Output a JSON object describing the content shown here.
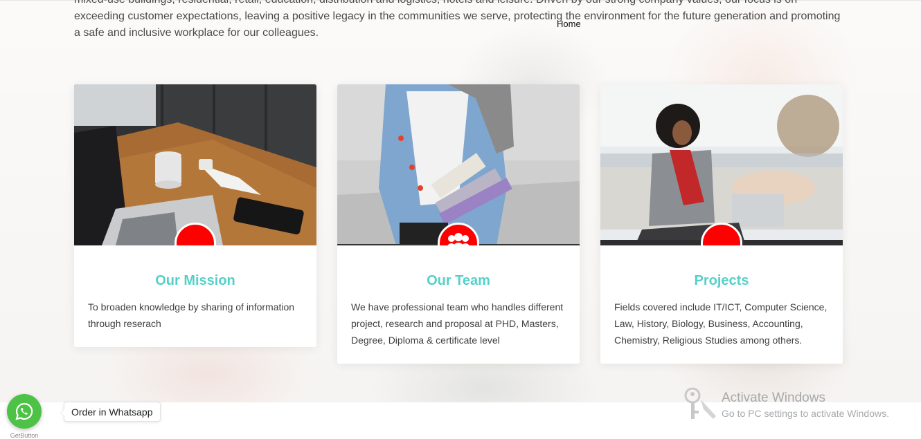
{
  "intro": {
    "text": "mixed-use buildings, residential, retail, education, distribution and logistics, hotels and leisure. Driven by our strong company values, our focus is on exceeding customer expectations, leaving a positive legacy in the communities we serve, protecting the environment for the future generation and promoting a safe and inclusive workplace for our colleagues."
  },
  "nav": {
    "home_label": "Home"
  },
  "cards": [
    {
      "title": "Our Mission",
      "text": "To broaden knowledge by sharing of information through reserach",
      "image": "laptop-coffee-desk-photo",
      "badge_icon": "none"
    },
    {
      "title": "Our Team",
      "text": "We have professional team who handles different project, research and proposal at PHD, Masters, Degree, Diploma & certificate level",
      "image": "student-holding-books-photo",
      "badge_icon": "users-icon"
    },
    {
      "title": "Projects",
      "text": "Fields covered include IT/ICT, Computer Science, Law, History, Biology, Business, Accounting, Chemistry, Religious Studies among others.",
      "image": "woman-with-laptop-cafe-photo",
      "badge_icon": "none"
    }
  ],
  "whatsapp": {
    "tooltip": "Order in Whatsapp",
    "caption": "GetButton",
    "icon": "whatsapp-icon"
  },
  "windows_watermark": {
    "title": "Activate Windows",
    "subtitle": "Go to PC settings to activate Windows."
  },
  "colors": {
    "accent_title": "#55d0c8",
    "badge": "#ff0000",
    "whatsapp_green": "#4dc247"
  }
}
